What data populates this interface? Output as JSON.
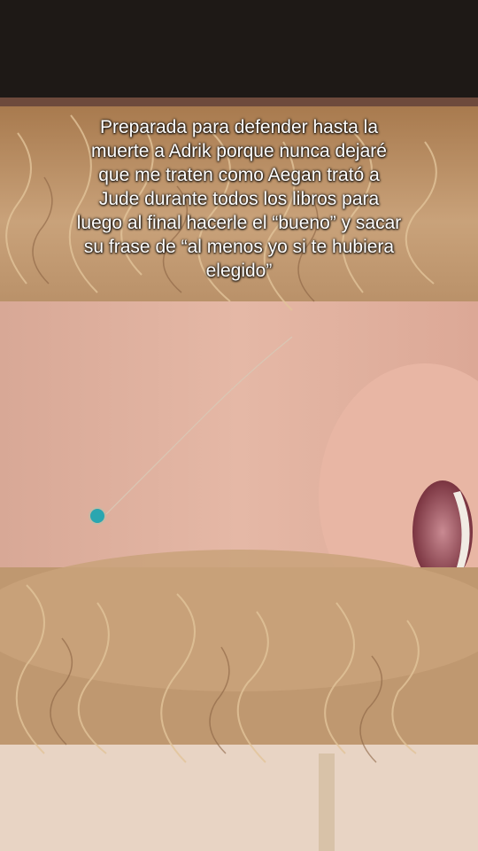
{
  "caption": {
    "lines": [
      "Preparada para defender hasta la",
      "muerte a Adrik porque nunca dejaré",
      "que me traten como Aegan trató a",
      "Jude durante todos los libros para",
      "luego al final hacerle el “bueno” y sacar",
      "su frase de “al menos yo si te hubiera",
      "elegido”"
    ]
  },
  "colors": {
    "caption_text": "#ffffff",
    "hair": "#c9a574",
    "skin": "#e3b4a2",
    "background_dark": "#1e1916",
    "pendant": "#2aa6b0"
  }
}
